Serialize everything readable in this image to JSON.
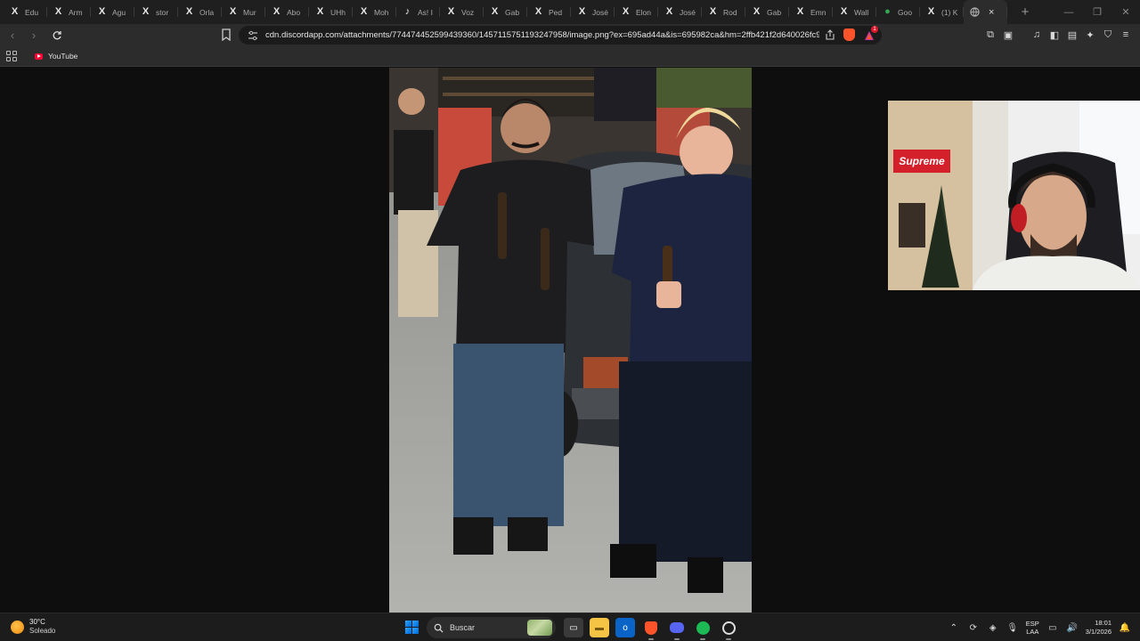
{
  "browser": {
    "tabs": [
      {
        "icon": "x-logo-icon",
        "glyph": "X",
        "title": "Edu"
      },
      {
        "icon": "x-logo-icon",
        "glyph": "X",
        "title": "Arm"
      },
      {
        "icon": "x-logo-icon",
        "glyph": "X",
        "title": "Agu"
      },
      {
        "icon": "x-logo-icon",
        "glyph": "X",
        "title": "stor"
      },
      {
        "icon": "x-logo-icon",
        "glyph": "X",
        "title": "Orla"
      },
      {
        "icon": "x-logo-icon",
        "glyph": "X",
        "title": "Mur"
      },
      {
        "icon": "x-logo-icon",
        "glyph": "X",
        "title": "Abo"
      },
      {
        "icon": "x-logo-icon",
        "glyph": "X",
        "title": "UHh"
      },
      {
        "icon": "x-logo-icon",
        "glyph": "X",
        "title": "Moh"
      },
      {
        "icon": "tiktok-icon",
        "glyph": "♪",
        "title": "As! I"
      },
      {
        "icon": "x-logo-icon",
        "glyph": "X",
        "title": "Voz"
      },
      {
        "icon": "x-logo-icon",
        "glyph": "X",
        "title": "Gab"
      },
      {
        "icon": "x-logo-icon",
        "glyph": "X",
        "title": "Ped"
      },
      {
        "icon": "x-logo-icon",
        "glyph": "X",
        "title": "José"
      },
      {
        "icon": "x-logo-icon",
        "glyph": "X",
        "title": "Elon"
      },
      {
        "icon": "x-logo-icon",
        "glyph": "X",
        "title": "José"
      },
      {
        "icon": "x-logo-icon",
        "glyph": "X",
        "title": "Rod"
      },
      {
        "icon": "x-logo-icon",
        "glyph": "X",
        "title": "Gab"
      },
      {
        "icon": "x-logo-icon",
        "glyph": "X",
        "title": "Emn"
      },
      {
        "icon": "x-logo-icon",
        "glyph": "X",
        "title": "Wall"
      },
      {
        "icon": "google-maps-icon",
        "glyph": "●",
        "title": "Goo"
      },
      {
        "icon": "x-logo-icon",
        "glyph": "X",
        "title": "(1) K"
      }
    ],
    "active_tab_close": "×",
    "new_tab": "+",
    "url": "cdn.discordapp.com/attachments/774474452599439360/1457115751193247958/image.png?ex=695ad44a&is=695982ca&hm=2ffb421f2d640026fc9...",
    "rewards_badge": "1",
    "bookmarks": [
      {
        "label": "YouTube"
      }
    ]
  },
  "taskbar": {
    "weather_temp": "30°C",
    "weather_desc": "Soleado",
    "search_label": "Buscar",
    "lang_top": "ESP",
    "lang_bottom": "LAA",
    "time": "18:01",
    "date": "3/1/2026"
  },
  "webcam": {
    "sign_text": "Supreme"
  },
  "colors": {
    "brave_orange": "#fb542b",
    "spotify_green": "#1db954",
    "discord_blurple": "#5865f2",
    "supreme_red": "#d3202a"
  }
}
